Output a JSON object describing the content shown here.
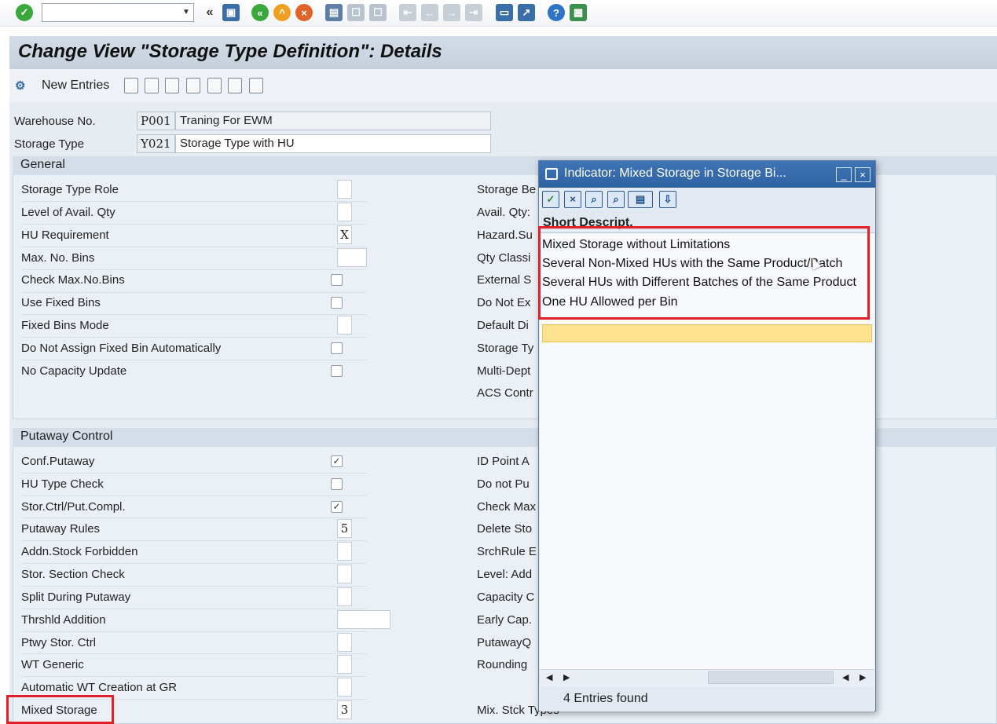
{
  "title": "Change View \"Storage Type Definition\": Details",
  "app_toolbar": {
    "new_entries": "New Entries"
  },
  "header": {
    "warehouse_label": "Warehouse No.",
    "warehouse_code": "P001",
    "warehouse_desc": "Traning For EWM",
    "storage_type_label": "Storage Type",
    "storage_type_code": "Y021",
    "storage_type_desc": "Storage Type with HU"
  },
  "general": {
    "title": "General",
    "left": [
      {
        "label": "Storage Type Role",
        "value": ""
      },
      {
        "label": "Level of Avail. Qty",
        "value": ""
      },
      {
        "label": "HU Requirement",
        "value": "X"
      },
      {
        "label": "Max. No. Bins",
        "value": ""
      },
      {
        "label": "Check Max.No.Bins",
        "value": ""
      },
      {
        "label": "Use Fixed Bins",
        "value": ""
      },
      {
        "label": "Fixed Bins Mode",
        "value": ""
      },
      {
        "label": "Do Not Assign Fixed Bin Automatically",
        "value": ""
      },
      {
        "label": "No Capacity Update",
        "value": ""
      }
    ],
    "right": [
      "Storage Be",
      "Avail. Qty:",
      "Hazard.Su",
      "Qty Classi",
      "External S",
      "Do Not Ex",
      "Default Di",
      "Storage Ty",
      "Multi-Dept",
      "ACS Contr"
    ]
  },
  "putaway": {
    "title": "Putaway Control",
    "left": [
      {
        "label": "Conf.Putaway",
        "value": "✓"
      },
      {
        "label": "HU Type Check",
        "value": ""
      },
      {
        "label": "Stor.Ctrl/Put.Compl.",
        "value": "✓"
      },
      {
        "label": "Putaway Rules",
        "value": "5"
      },
      {
        "label": "Addn.Stock Forbidden",
        "value": ""
      },
      {
        "label": "Stor. Section Check",
        "value": ""
      },
      {
        "label": "Split During Putaway",
        "value": ""
      },
      {
        "label": "Thrshld Addition",
        "value": ""
      },
      {
        "label": "Ptwy Stor. Ctrl",
        "value": ""
      },
      {
        "label": "WT Generic",
        "value": ""
      },
      {
        "label": "Automatic WT Creation at GR",
        "value": ""
      },
      {
        "label": "Mixed Storage",
        "value": "3"
      }
    ],
    "right": [
      "ID Point A",
      "Do not Pu",
      "Check Max",
      "Delete Sto",
      "SrchRule E",
      "Level: Add",
      "Capacity C",
      "Early Cap.",
      "PutawayQ",
      "Rounding",
      "",
      "Mix. Stck Types"
    ]
  },
  "popup": {
    "title": "Indicator: Mixed Storage in Storage Bi...",
    "column": "Short Descript.",
    "items": [
      "Mixed Storage without Limitations",
      "Several Non-Mixed HUs with the Same Product/Batch",
      "Several HUs with Different Batches of the Same Product",
      "One HU Allowed per Bin"
    ],
    "status": "4 Entries found",
    "selected_index": 1
  },
  "colors": {
    "highlight": "#e21e26",
    "popup_title": "#3f74b5",
    "selection": "#fde38f"
  }
}
